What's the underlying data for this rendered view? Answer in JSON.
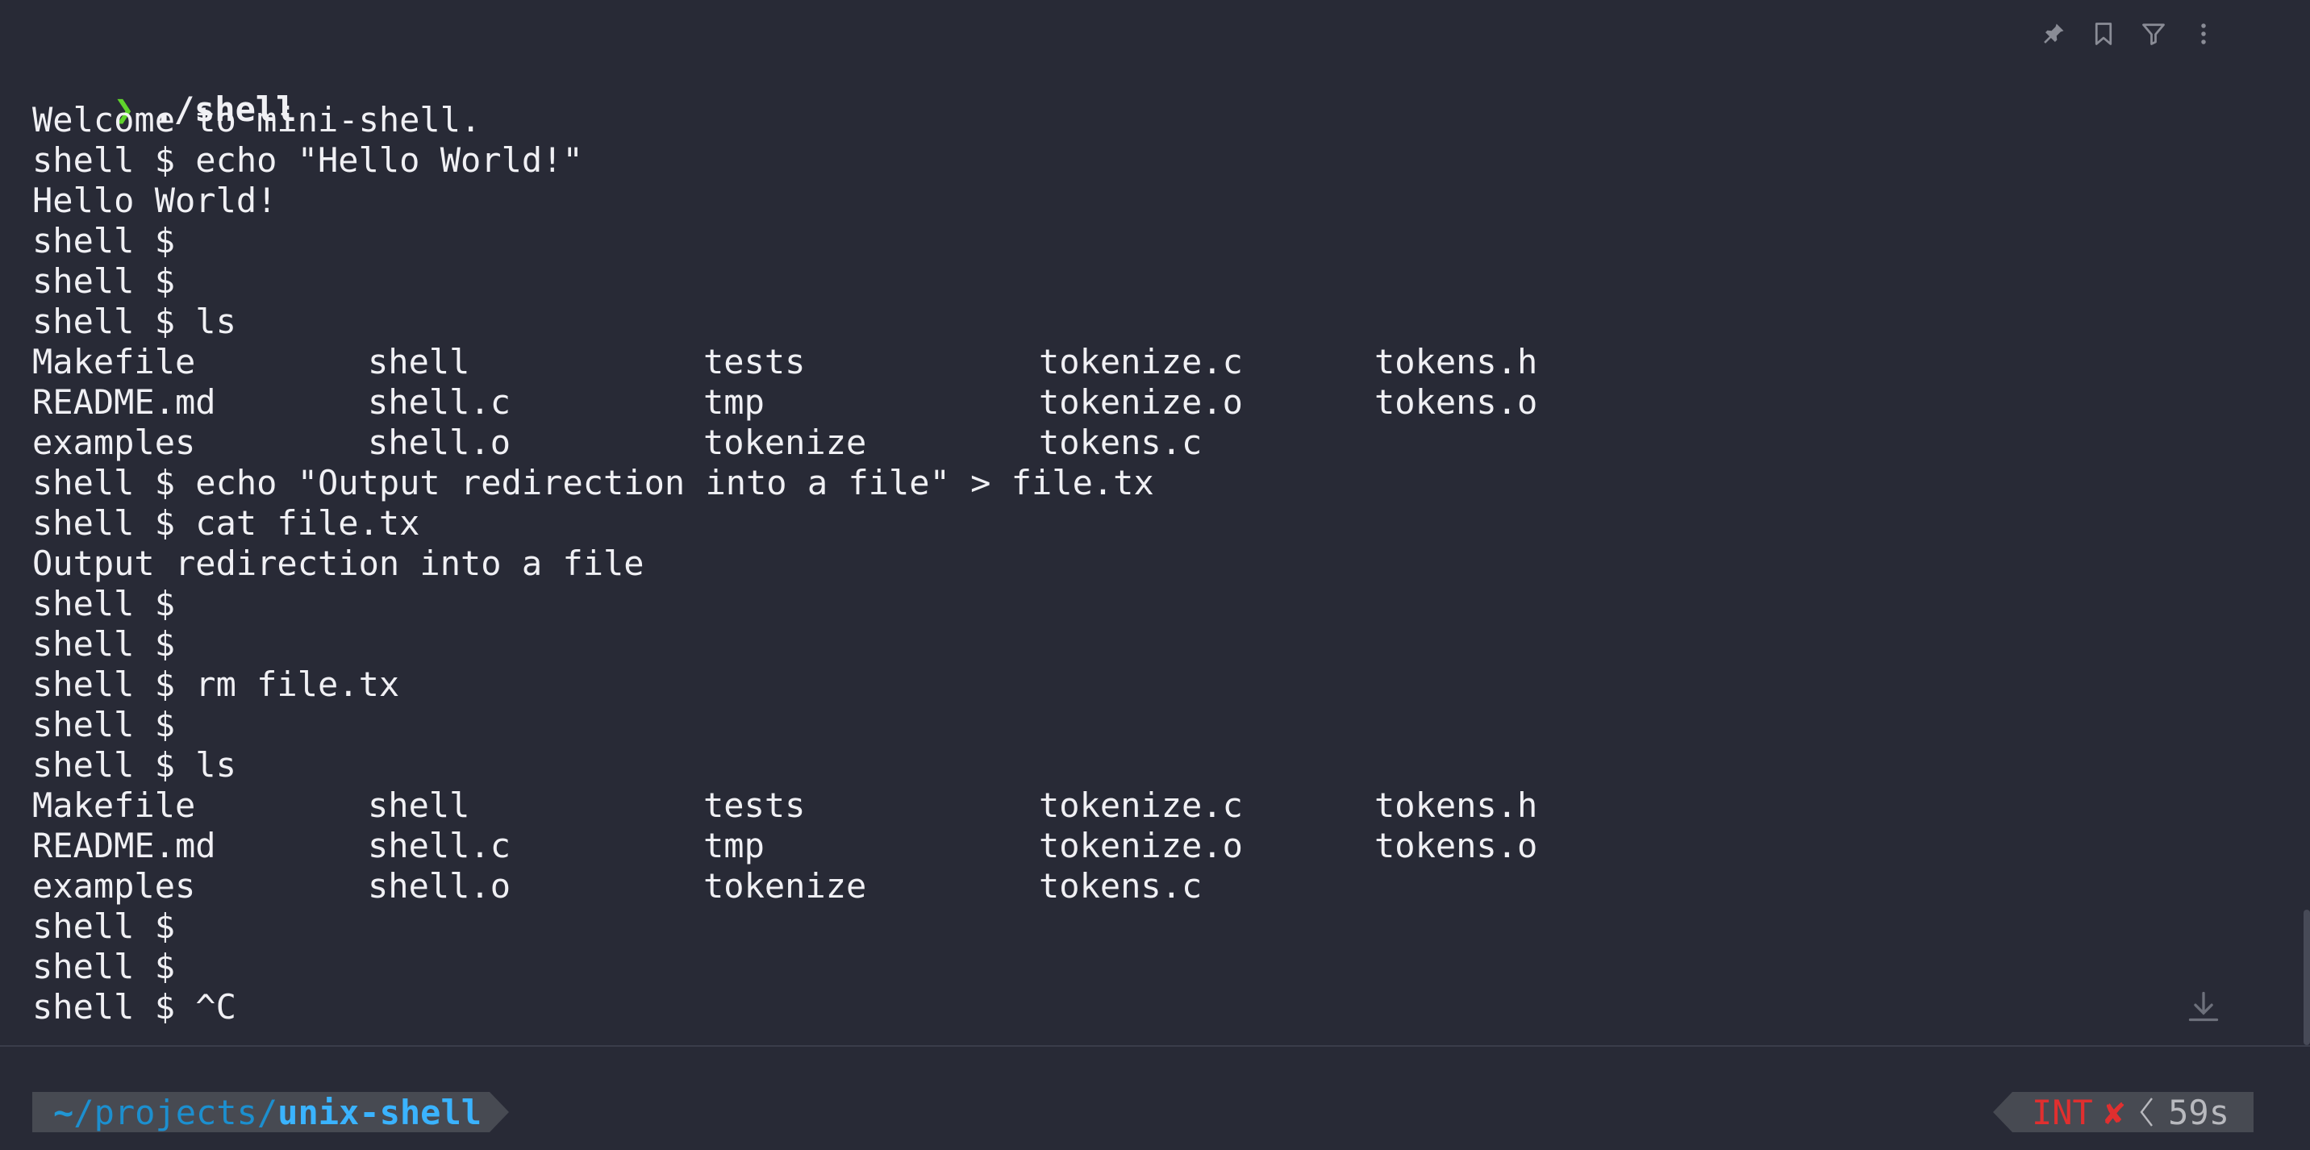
{
  "block": {
    "prompt_symbol": "❯",
    "command": "./shell",
    "lines": [
      {
        "type": "text",
        "text": "Welcome to mini-shell."
      },
      {
        "type": "text",
        "text": "shell $ echo \"Hello World!\""
      },
      {
        "type": "text",
        "text": "Hello World!"
      },
      {
        "type": "text",
        "text": "shell $"
      },
      {
        "type": "text",
        "text": "shell $"
      },
      {
        "type": "text",
        "text": "shell $ ls"
      },
      {
        "type": "cols",
        "cells": [
          "Makefile",
          "shell",
          "tests",
          "tokenize.c",
          "tokens.h"
        ]
      },
      {
        "type": "cols",
        "cells": [
          "README.md",
          "shell.c",
          "tmp",
          "tokenize.o",
          "tokens.o"
        ]
      },
      {
        "type": "cols",
        "cells": [
          "examples",
          "shell.o",
          "tokenize",
          "tokens.c"
        ]
      },
      {
        "type": "text",
        "text": "shell $ echo \"Output redirection into a file\" > file.tx"
      },
      {
        "type": "text",
        "text": "shell $ cat file.tx"
      },
      {
        "type": "text",
        "text": "Output redirection into a file"
      },
      {
        "type": "text",
        "text": "shell $"
      },
      {
        "type": "text",
        "text": "shell $"
      },
      {
        "type": "text",
        "text": "shell $ rm file.tx"
      },
      {
        "type": "text",
        "text": "shell $"
      },
      {
        "type": "text",
        "text": "shell $ ls"
      },
      {
        "type": "cols",
        "cells": [
          "Makefile",
          "shell",
          "tests",
          "tokenize.c",
          "tokens.h"
        ]
      },
      {
        "type": "cols",
        "cells": [
          "README.md",
          "shell.c",
          "tmp",
          "tokenize.o",
          "tokens.o"
        ]
      },
      {
        "type": "cols",
        "cells": [
          "examples",
          "shell.o",
          "tokenize",
          "tokens.c"
        ]
      },
      {
        "type": "text",
        "text": "shell $"
      },
      {
        "type": "text",
        "text": "shell $"
      },
      {
        "type": "text",
        "text": "shell $ ^C"
      }
    ],
    "toolbar": {
      "icons": [
        "pin-icon",
        "bookmark-icon",
        "filter-icon",
        "more-icon"
      ]
    }
  },
  "prompt": {
    "path_home": "~",
    "path_middle": "/projects/",
    "path_current": "unix-shell",
    "status_code": "INT",
    "status_mark": "✘",
    "duration": "59s"
  },
  "colors": {
    "background": "#282a36",
    "prompt_chevron": "#5fd32c",
    "path": "#3ab3ff",
    "error": "#e02f2f",
    "segment_bg": "#474a52"
  }
}
